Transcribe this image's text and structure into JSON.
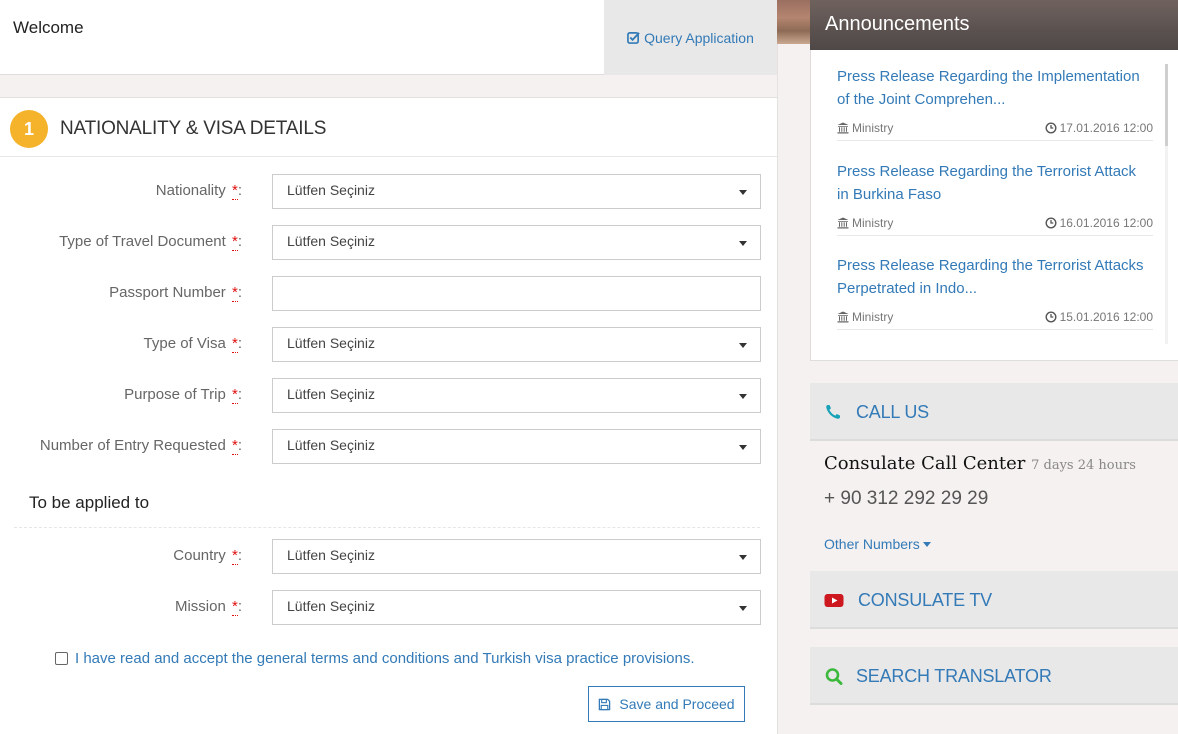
{
  "header": {
    "welcome": "Welcome",
    "query_application": "Query Application"
  },
  "form": {
    "step_number": "1",
    "title": "NATIONALITY & VISA DETAILS",
    "required_mark": "*",
    "colon": ":",
    "fields": [
      {
        "label": "Nationality",
        "type": "select",
        "value": "Lütfen Seçiniz"
      },
      {
        "label": "Type of Travel Document",
        "type": "select",
        "value": "Lütfen Seçiniz"
      },
      {
        "label": "Passport Number",
        "type": "text",
        "value": ""
      },
      {
        "label": "Type of Visa",
        "type": "select",
        "value": "Lütfen Seçiniz"
      },
      {
        "label": "Purpose of Trip",
        "type": "select",
        "value": "Lütfen Seçiniz"
      },
      {
        "label": "Number of Entry Requested",
        "type": "select",
        "value": "Lütfen Seçiniz"
      }
    ],
    "subsection_title": "To be applied to",
    "applied_fields": [
      {
        "label": "Country",
        "type": "select",
        "value": "Lütfen Seçiniz"
      },
      {
        "label": "Mission",
        "type": "select",
        "value": "Lütfen Seçiniz"
      }
    ],
    "terms_label": "I have read and accept the general terms and conditions and Turkish visa practice provisions.",
    "terms_checked": false,
    "save_label": "Save and Proceed"
  },
  "announcements": {
    "title": "Announcements",
    "items": [
      {
        "title_line1": "Press Release Regarding the Implementation",
        "title_line2": "of the Joint Comprehen...",
        "source": "Ministry",
        "date": "17.01.2016 12:00"
      },
      {
        "title_line1": "Press Release Regarding the Terrorist Attack",
        "title_line2": "in Burkina Faso",
        "source": "Ministry",
        "date": "16.01.2016 12:00"
      },
      {
        "title_line1": "Press Release Regarding the Terrorist Attacks",
        "title_line2": "Perpetrated in Indo...",
        "source": "Ministry",
        "date": "15.01.2016 12:00"
      }
    ]
  },
  "call_us": {
    "label": "CALL US",
    "center_name": "Consulate Call Center",
    "hours": "7 days 24 hours",
    "phone": "+ 90 312 292 29 29",
    "other_numbers": "Other Numbers"
  },
  "consulate_tv": {
    "label": "CONSULATE TV"
  },
  "search_translator": {
    "label": "SEARCH TRANSLATOR"
  },
  "colors": {
    "accent": "#337ab7",
    "step_badge": "#f5b22b",
    "required": "#e01010",
    "phone_icon": "#17a2b8",
    "tv_icon": "#cc181e",
    "search_icon": "#3cb93c"
  }
}
